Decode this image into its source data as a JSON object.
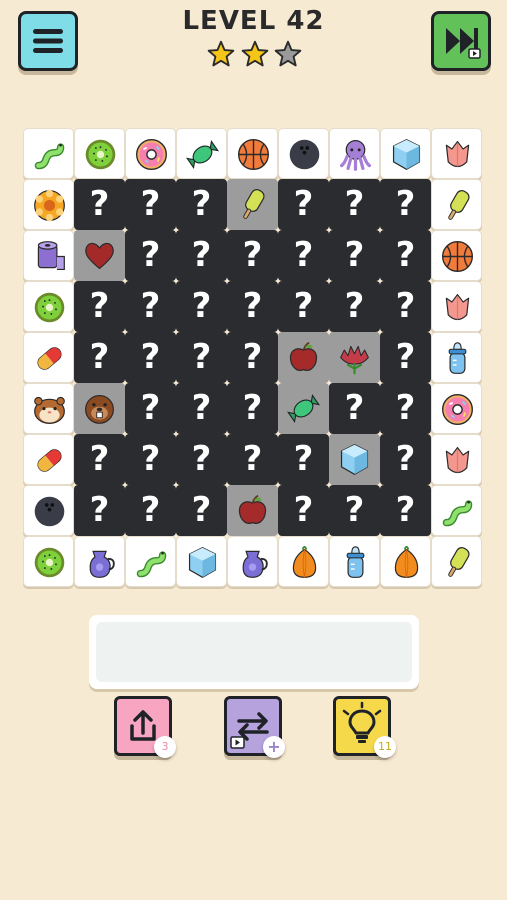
{
  "header": {
    "level_title": "LEVEL 42",
    "stars_earned": 2,
    "stars_total": 3,
    "menu_icon": "menu-icon",
    "skip_icon": "fast-forward-video-icon"
  },
  "board": {
    "columns": 9,
    "rows": 9,
    "hidden_glyph": "?",
    "tiles": [
      [
        {
          "s": "open",
          "item": "worm"
        },
        {
          "s": "open",
          "item": "kiwi"
        },
        {
          "s": "open",
          "item": "donut"
        },
        {
          "s": "open",
          "item": "candy"
        },
        {
          "s": "open",
          "item": "basketball"
        },
        {
          "s": "open",
          "item": "bowling-ball"
        },
        {
          "s": "open",
          "item": "octopus"
        },
        {
          "s": "open",
          "item": "ice-cube"
        },
        {
          "s": "open",
          "item": "tulip"
        }
      ],
      [
        {
          "s": "open",
          "item": "pie"
        },
        {
          "s": "hidden"
        },
        {
          "s": "hidden"
        },
        {
          "s": "hidden"
        },
        {
          "s": "revealed",
          "item": "popsicle"
        },
        {
          "s": "hidden"
        },
        {
          "s": "hidden"
        },
        {
          "s": "hidden"
        },
        {
          "s": "open",
          "item": "popsicle"
        }
      ],
      [
        {
          "s": "open",
          "item": "toilet-paper"
        },
        {
          "s": "revealed",
          "item": "heart"
        },
        {
          "s": "hidden"
        },
        {
          "s": "hidden"
        },
        {
          "s": "hidden"
        },
        {
          "s": "hidden"
        },
        {
          "s": "hidden"
        },
        {
          "s": "hidden"
        },
        {
          "s": "open",
          "item": "basketball"
        }
      ],
      [
        {
          "s": "open",
          "item": "kiwi"
        },
        {
          "s": "hidden"
        },
        {
          "s": "hidden"
        },
        {
          "s": "hidden"
        },
        {
          "s": "hidden"
        },
        {
          "s": "hidden"
        },
        {
          "s": "hidden"
        },
        {
          "s": "hidden"
        },
        {
          "s": "open",
          "item": "tulip"
        }
      ],
      [
        {
          "s": "open",
          "item": "pill"
        },
        {
          "s": "hidden"
        },
        {
          "s": "hidden"
        },
        {
          "s": "hidden"
        },
        {
          "s": "hidden"
        },
        {
          "s": "revealed",
          "item": "apple"
        },
        {
          "s": "revealed",
          "item": "carnation"
        },
        {
          "s": "hidden"
        },
        {
          "s": "open",
          "item": "baby-bottle"
        }
      ],
      [
        {
          "s": "open",
          "item": "hamster"
        },
        {
          "s": "revealed",
          "item": "beaver"
        },
        {
          "s": "hidden"
        },
        {
          "s": "hidden"
        },
        {
          "s": "hidden"
        },
        {
          "s": "revealed",
          "item": "candy"
        },
        {
          "s": "hidden"
        },
        {
          "s": "hidden"
        },
        {
          "s": "open",
          "item": "donut"
        }
      ],
      [
        {
          "s": "open",
          "item": "pill"
        },
        {
          "s": "hidden"
        },
        {
          "s": "hidden"
        },
        {
          "s": "hidden"
        },
        {
          "s": "hidden"
        },
        {
          "s": "hidden"
        },
        {
          "s": "revealed",
          "item": "ice-cube"
        },
        {
          "s": "hidden"
        },
        {
          "s": "open",
          "item": "tulip"
        }
      ],
      [
        {
          "s": "open",
          "item": "bowling-ball"
        },
        {
          "s": "hidden"
        },
        {
          "s": "hidden"
        },
        {
          "s": "hidden"
        },
        {
          "s": "revealed",
          "item": "apple"
        },
        {
          "s": "hidden"
        },
        {
          "s": "hidden"
        },
        {
          "s": "hidden"
        },
        {
          "s": "open",
          "item": "worm"
        }
      ],
      [
        {
          "s": "open",
          "item": "kiwi"
        },
        {
          "s": "open",
          "item": "jug"
        },
        {
          "s": "open",
          "item": "worm"
        },
        {
          "s": "open",
          "item": "ice-cube"
        },
        {
          "s": "open",
          "item": "jug"
        },
        {
          "s": "open",
          "item": "onion"
        },
        {
          "s": "open",
          "item": "baby-bottle"
        },
        {
          "s": "open",
          "item": "onion"
        },
        {
          "s": "open",
          "item": "popsicle"
        }
      ]
    ]
  },
  "tray": {
    "slots_filled": 0
  },
  "powerups": {
    "undo": {
      "icon": "undo-arrow-icon",
      "count": "3"
    },
    "shuffle": {
      "icon": "shuffle-icon",
      "badge": "+"
    },
    "hint": {
      "icon": "lightbulb-icon",
      "count": "11"
    }
  },
  "colors": {
    "background": "#f7ead3",
    "menu_button": "#7fdde8",
    "skip_button": "#63c15a",
    "hidden_tile": "#2a2c30",
    "revealed_tile": "#9c9c9c",
    "star_filled": "#f5c518",
    "star_empty": "#9a9a9a",
    "undo_button": "#f8a5c2",
    "shuffle_button": "#b6a2dc",
    "hint_button": "#f6d94a"
  }
}
